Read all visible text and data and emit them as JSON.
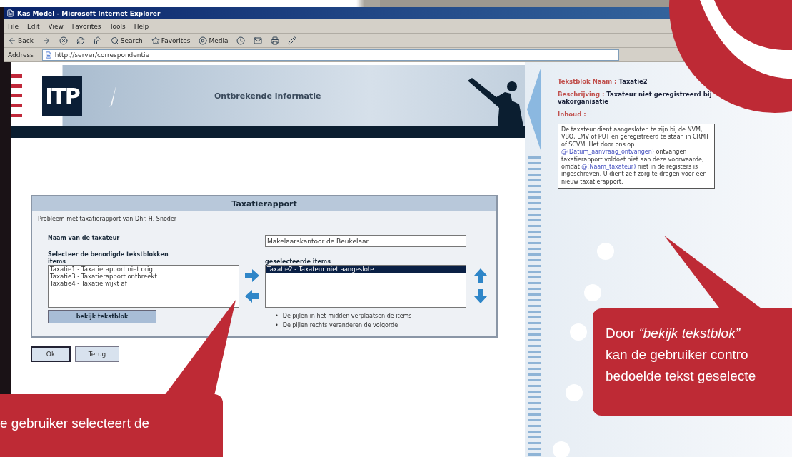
{
  "window": {
    "title": "Kas Model - Microsoft Internet Explorer"
  },
  "menu": [
    "File",
    "Edit",
    "View",
    "Favorites",
    "Tools",
    "Help"
  ],
  "toolbar": [
    {
      "kind": "back",
      "label": "Back"
    },
    {
      "kind": "forward"
    },
    {
      "kind": "stop"
    },
    {
      "kind": "refresh"
    },
    {
      "kind": "home"
    },
    {
      "kind": "search",
      "label": "Search"
    },
    {
      "kind": "favorites",
      "label": "Favorites"
    },
    {
      "kind": "media",
      "label": "Media"
    },
    {
      "kind": "history"
    },
    {
      "kind": "mail"
    },
    {
      "kind": "print"
    },
    {
      "kind": "edit"
    }
  ],
  "address": {
    "label": "Address",
    "url": "http://server/correspondentie"
  },
  "header": {
    "logo": "ITP",
    "title": "Ontbrekende informatie"
  },
  "form": {
    "title": "Taxatierapport",
    "subtitle": "Probleem met taxatierapport van Dhr. H. Snoder",
    "name_label": "Naam van de taxateur",
    "name_value": "Makelaarskantoor de Beukelaar",
    "select_label": "Selecteer de benodigde tekstblokken",
    "items_label": "items",
    "items": [
      {
        "label": "Taxatie1 - Taxatierapport niet orig...",
        "selected": false
      },
      {
        "label": "Taxatie3 - Taxatierapport ontbreekt",
        "selected": false
      },
      {
        "label": "Taxatie4 - Taxatie wijkt af",
        "selected": false
      }
    ],
    "selected_label": "geselecteerde items",
    "selected_items": [
      {
        "label": "Taxatie2 - Taxateur niet aangeslote...",
        "selected": true
      }
    ],
    "view_button": "bekijk tekstblok",
    "notes": [
      {
        "marker": "•",
        "text": "De pijlen in het midden verplaatsen de items"
      },
      {
        "marker": "•",
        "text": "De pijlen rechts veranderen de volgorde"
      }
    ]
  },
  "buttons": [
    {
      "label": "Ok",
      "default": true
    },
    {
      "label": "Terug",
      "default": false
    }
  ],
  "detail": {
    "name_label": "Tekstblok Naam :",
    "name_value": "Taxatie2",
    "description_label": "Beschrijving :",
    "description": "Taxateur niet geregistreerd bij vakorganisatie",
    "content_label": "Inhoud :",
    "content": [
      {
        "kind": "plain",
        "text": "De taxateur dient aangesloten te zijn bij de NVM, VBO, LMV of PUT en geregistreerd te staan in CRMT of SCVM. Het door ons op "
      },
      {
        "kind": "field",
        "text": "@(Datum_aanvraag_ontvangen)"
      },
      {
        "kind": "plain",
        "text": " ontvangen taxatierapport voldoet niet aan deze voorwaarde, omdat "
      },
      {
        "kind": "field",
        "text": "@(Naam_taxateur)"
      },
      {
        "kind": "plain",
        "text": " niet in de registers is ingeschreven. U dient zelf zorg te dragen voor een nieuw taxatierapport."
      }
    ]
  },
  "callouts": [
    {
      "kind": "left",
      "lines": [
        "e gebruiker selecteert de"
      ]
    },
    {
      "kind": "right",
      "lines": [
        "Door *“bekijk tekstblok”*",
        "kan de gebruiker contro",
        "bedoelde tekst geselecte"
      ]
    }
  ]
}
